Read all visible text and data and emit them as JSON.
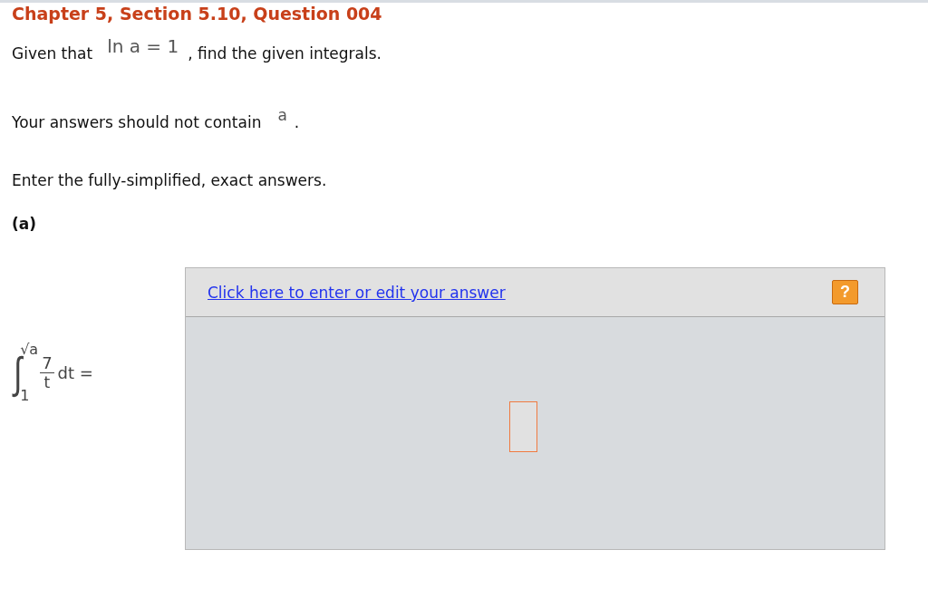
{
  "title": "Chapter 5, Section 5.10, Question 004",
  "intro": {
    "before": "Given that",
    "math": "ln a = 1",
    "after": ", find the given integrals."
  },
  "note": {
    "before": "Your answers should not contain",
    "math": "a",
    "after": "."
  },
  "instruction": "Enter the fully-simplified, exact answers.",
  "part": {
    "label": "(a)",
    "integral": {
      "sign": "∫",
      "upper": "√a",
      "lower": "1",
      "numerator": "7",
      "denominator": "t",
      "differential": "dt ="
    },
    "answer": {
      "link": "Click here to enter or edit your answer",
      "help": "?"
    }
  }
}
